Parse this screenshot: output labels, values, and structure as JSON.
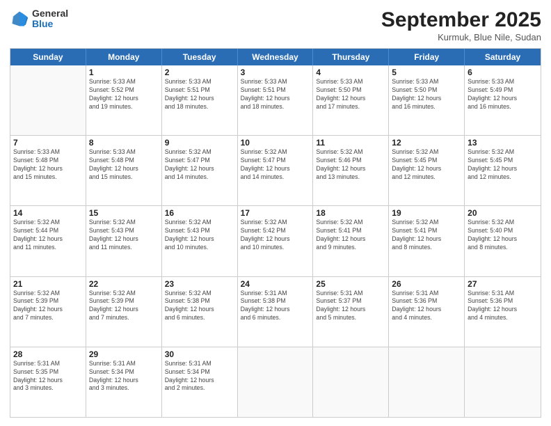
{
  "logo": {
    "general": "General",
    "blue": "Blue"
  },
  "header": {
    "month": "September 2025",
    "location": "Kurmuk, Blue Nile, Sudan"
  },
  "weekdays": [
    "Sunday",
    "Monday",
    "Tuesday",
    "Wednesday",
    "Thursday",
    "Friday",
    "Saturday"
  ],
  "rows": [
    [
      {
        "day": "",
        "info": ""
      },
      {
        "day": "1",
        "info": "Sunrise: 5:33 AM\nSunset: 5:52 PM\nDaylight: 12 hours\nand 19 minutes."
      },
      {
        "day": "2",
        "info": "Sunrise: 5:33 AM\nSunset: 5:51 PM\nDaylight: 12 hours\nand 18 minutes."
      },
      {
        "day": "3",
        "info": "Sunrise: 5:33 AM\nSunset: 5:51 PM\nDaylight: 12 hours\nand 18 minutes."
      },
      {
        "day": "4",
        "info": "Sunrise: 5:33 AM\nSunset: 5:50 PM\nDaylight: 12 hours\nand 17 minutes."
      },
      {
        "day": "5",
        "info": "Sunrise: 5:33 AM\nSunset: 5:50 PM\nDaylight: 12 hours\nand 16 minutes."
      },
      {
        "day": "6",
        "info": "Sunrise: 5:33 AM\nSunset: 5:49 PM\nDaylight: 12 hours\nand 16 minutes."
      }
    ],
    [
      {
        "day": "7",
        "info": "Sunrise: 5:33 AM\nSunset: 5:48 PM\nDaylight: 12 hours\nand 15 minutes."
      },
      {
        "day": "8",
        "info": "Sunrise: 5:33 AM\nSunset: 5:48 PM\nDaylight: 12 hours\nand 15 minutes."
      },
      {
        "day": "9",
        "info": "Sunrise: 5:32 AM\nSunset: 5:47 PM\nDaylight: 12 hours\nand 14 minutes."
      },
      {
        "day": "10",
        "info": "Sunrise: 5:32 AM\nSunset: 5:47 PM\nDaylight: 12 hours\nand 14 minutes."
      },
      {
        "day": "11",
        "info": "Sunrise: 5:32 AM\nSunset: 5:46 PM\nDaylight: 12 hours\nand 13 minutes."
      },
      {
        "day": "12",
        "info": "Sunrise: 5:32 AM\nSunset: 5:45 PM\nDaylight: 12 hours\nand 12 minutes."
      },
      {
        "day": "13",
        "info": "Sunrise: 5:32 AM\nSunset: 5:45 PM\nDaylight: 12 hours\nand 12 minutes."
      }
    ],
    [
      {
        "day": "14",
        "info": "Sunrise: 5:32 AM\nSunset: 5:44 PM\nDaylight: 12 hours\nand 11 minutes."
      },
      {
        "day": "15",
        "info": "Sunrise: 5:32 AM\nSunset: 5:43 PM\nDaylight: 12 hours\nand 11 minutes."
      },
      {
        "day": "16",
        "info": "Sunrise: 5:32 AM\nSunset: 5:43 PM\nDaylight: 12 hours\nand 10 minutes."
      },
      {
        "day": "17",
        "info": "Sunrise: 5:32 AM\nSunset: 5:42 PM\nDaylight: 12 hours\nand 10 minutes."
      },
      {
        "day": "18",
        "info": "Sunrise: 5:32 AM\nSunset: 5:41 PM\nDaylight: 12 hours\nand 9 minutes."
      },
      {
        "day": "19",
        "info": "Sunrise: 5:32 AM\nSunset: 5:41 PM\nDaylight: 12 hours\nand 8 minutes."
      },
      {
        "day": "20",
        "info": "Sunrise: 5:32 AM\nSunset: 5:40 PM\nDaylight: 12 hours\nand 8 minutes."
      }
    ],
    [
      {
        "day": "21",
        "info": "Sunrise: 5:32 AM\nSunset: 5:39 PM\nDaylight: 12 hours\nand 7 minutes."
      },
      {
        "day": "22",
        "info": "Sunrise: 5:32 AM\nSunset: 5:39 PM\nDaylight: 12 hours\nand 7 minutes."
      },
      {
        "day": "23",
        "info": "Sunrise: 5:32 AM\nSunset: 5:38 PM\nDaylight: 12 hours\nand 6 minutes."
      },
      {
        "day": "24",
        "info": "Sunrise: 5:31 AM\nSunset: 5:38 PM\nDaylight: 12 hours\nand 6 minutes."
      },
      {
        "day": "25",
        "info": "Sunrise: 5:31 AM\nSunset: 5:37 PM\nDaylight: 12 hours\nand 5 minutes."
      },
      {
        "day": "26",
        "info": "Sunrise: 5:31 AM\nSunset: 5:36 PM\nDaylight: 12 hours\nand 4 minutes."
      },
      {
        "day": "27",
        "info": "Sunrise: 5:31 AM\nSunset: 5:36 PM\nDaylight: 12 hours\nand 4 minutes."
      }
    ],
    [
      {
        "day": "28",
        "info": "Sunrise: 5:31 AM\nSunset: 5:35 PM\nDaylight: 12 hours\nand 3 minutes."
      },
      {
        "day": "29",
        "info": "Sunrise: 5:31 AM\nSunset: 5:34 PM\nDaylight: 12 hours\nand 3 minutes."
      },
      {
        "day": "30",
        "info": "Sunrise: 5:31 AM\nSunset: 5:34 PM\nDaylight: 12 hours\nand 2 minutes."
      },
      {
        "day": "",
        "info": ""
      },
      {
        "day": "",
        "info": ""
      },
      {
        "day": "",
        "info": ""
      },
      {
        "day": "",
        "info": ""
      }
    ]
  ]
}
